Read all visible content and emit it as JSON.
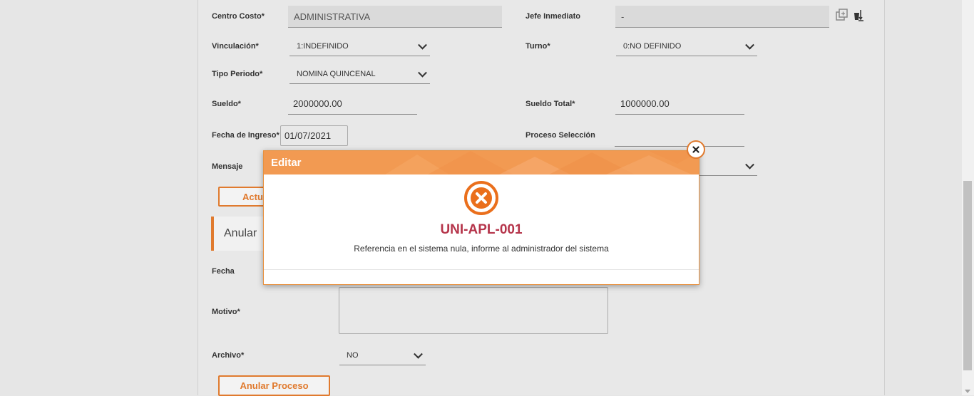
{
  "form": {
    "centro_costo": {
      "label": "Centro Costo*",
      "value": "ADMINISTRATIVA"
    },
    "jefe_inmediato": {
      "label": "Jefe Inmediato",
      "value": "-"
    },
    "vinculacion": {
      "label": "Vinculación*",
      "value": "1:INDEFINIDO"
    },
    "turno": {
      "label": "Turno*",
      "value": "0:NO DEFINIDO"
    },
    "tipo_periodo": {
      "label": "Tipo Periodo*",
      "value": "NOMINA QUINCENAL"
    },
    "sueldo": {
      "label": "Sueldo*",
      "value": "2000000.00"
    },
    "sueldo_total": {
      "label": "Sueldo Total*",
      "value": "1000000.00"
    },
    "fecha_ingreso": {
      "label": "Fecha de Ingreso*",
      "value": "01/07/2021"
    },
    "proceso_seleccion": {
      "label": "Proceso Selección",
      "value": ""
    },
    "mensaje": {
      "label": "Mensaje"
    },
    "actualizar_button": "Actu"
  },
  "anular": {
    "section_title": "Anular",
    "fecha_label": "Fecha",
    "motivo_label": "Motivo*",
    "archivo_label": "Archivo*",
    "archivo_value": "NO",
    "anular_button": "Anular Proceso"
  },
  "dialog": {
    "title": "Editar",
    "error_code": "UNI-APL-001",
    "error_message": "Referencia en el sistema nula, informe al administrador del sistema"
  },
  "icons": {
    "error": "circle-x-icon",
    "close": "close-icon",
    "side": [
      "copy-icon",
      "bucket-icon"
    ]
  },
  "colors": {
    "accent": "#e07a2e",
    "dialog_header": "#f29a52",
    "error_code": "#b5344a"
  }
}
